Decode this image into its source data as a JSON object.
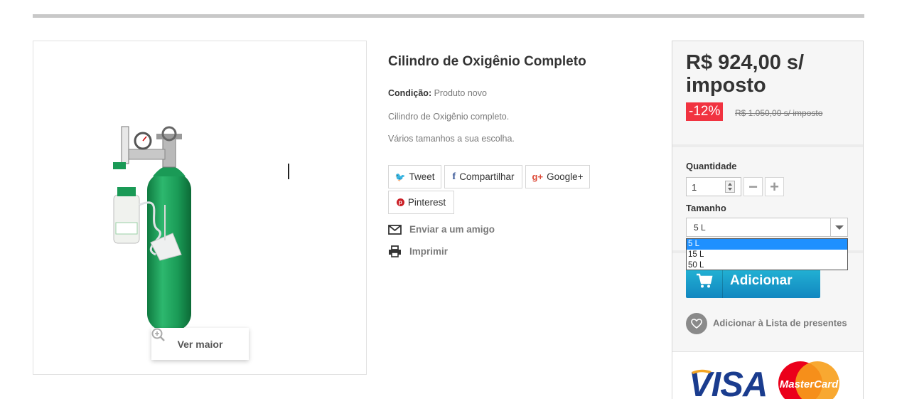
{
  "product": {
    "title": "Cilindro de Oxigênio Completo",
    "condition_label": "Condição:",
    "condition_value": "Produto novo",
    "description_1": "Cilindro de Oxigênio completo.",
    "description_2": "Vários tamanhos a sua escolha.",
    "zoom_label": "Ver maior"
  },
  "share": {
    "tweet": "Tweet",
    "facebook": "Compartilhar",
    "google": "Google+",
    "pinterest": "Pinterest"
  },
  "actions": {
    "send_friend": "Enviar a um amigo",
    "print": "Imprimir"
  },
  "buy_box": {
    "price": "R$ 924,00 s/ imposto",
    "discount": "-12%",
    "old_price": "R$ 1.050,00 s/ imposto",
    "quantity_label": "Quantidade",
    "quantity_value": "1",
    "size_label": "Tamanho",
    "size_selected": "5 L",
    "size_options": [
      "5 L",
      "15 L",
      "50 L"
    ],
    "add_label": "Adicionar",
    "wishlist_label": "Adicionar à Lista de presentes",
    "payment_visa": "VISA",
    "payment_mastercard": "MasterCard"
  },
  "colors": {
    "accent": "#25b9d7",
    "discount": "#f13340",
    "cylinder_green": "#1e9a5a"
  }
}
